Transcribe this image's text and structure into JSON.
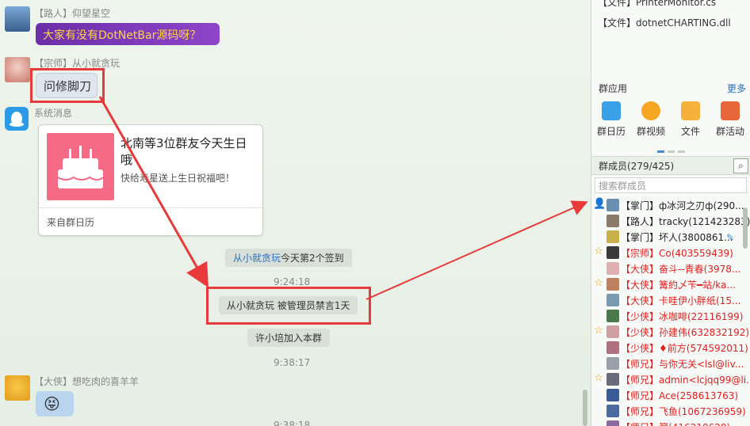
{
  "messages": [
    {
      "sender": "【路人】仰望星空",
      "text": "大家有没有DotNetBar源码呀？"
    },
    {
      "sender": "【宗师】从小就贪玩",
      "text": "问修脚刀"
    },
    {
      "sender": "系统消息"
    },
    {
      "sender": "【大侠】想吃肉的喜羊羊",
      "text": "😝"
    }
  ],
  "card": {
    "title": "北南等3位群友今天生日哦",
    "subtitle": "快给寿星送上生日祝福吧！",
    "footer": "来自群日历"
  },
  "system": {
    "signin_user": "从小就贪玩",
    "signin_text": "今天第2个签到",
    "time1": "9:24:18",
    "mute_text": "从小就贪玩 被管理员禁言1天",
    "join_text": "许小培加入本群",
    "time2": "9:38:17",
    "time3": "9:38:18"
  },
  "sidebar": {
    "files": [
      "【文件】PrinterMonitor.cs",
      "【文件】dotnetCHARTING.dll"
    ],
    "apps_title": "群应用",
    "apps_more": "更多",
    "apps": [
      "群日历",
      "群视频",
      "文件",
      "群活动"
    ],
    "members_title": "群成员(279/425)",
    "search_placeholder": "搜索群成员",
    "members": [
      {
        "text": "【掌门】ф冰河之刃ф(290...",
        "color": "#222222",
        "badge": "person-icon"
      },
      {
        "text": "【路人】tracky(121423283)",
        "color": "#222222",
        "badge": ""
      },
      {
        "text": "【掌门】坏人(3800861...",
        "color": "#222222",
        "badge": ""
      },
      {
        "text": "【宗师】Co(403559439)",
        "color": "#e02020",
        "badge": "star-icon"
      },
      {
        "text": "【大侠】奋斗--青春(3978...",
        "color": "#e02020",
        "badge": ""
      },
      {
        "text": "【大侠】篝約乄苄━站/ka...",
        "color": "#e02020",
        "badge": "star-icon"
      },
      {
        "text": "【大侠】卡哇伊小胖纸(15...",
        "color": "#e02020",
        "badge": ""
      },
      {
        "text": "【少侠】冰咖啡(22116199)",
        "color": "#e02020",
        "badge": ""
      },
      {
        "text": "【少侠】孙建伟(632832192)",
        "color": "#e02020",
        "badge": "star-icon"
      },
      {
        "text": "【少侠】♦前方(574592011)",
        "color": "#e02020",
        "badge": ""
      },
      {
        "text": "【师兄】与你无关<lsl@liv...",
        "color": "#e02020",
        "badge": ""
      },
      {
        "text": "【师兄】admin<lcjqq99@li...",
        "color": "#e02020",
        "badge": "star-icon"
      },
      {
        "text": "【师兄】Ace(258613763)",
        "color": "#e02020",
        "badge": ""
      },
      {
        "text": "【师兄】飞鱼(1067236959)",
        "color": "#e02020",
        "badge": ""
      },
      {
        "text": "【师兄】翠(416210620)",
        "color": "#e02020",
        "badge": ""
      }
    ]
  },
  "colors": {
    "accent_red": "#e83a3a",
    "purple_bubble": "#7b3fb5",
    "link_blue": "#2a6fc4"
  }
}
